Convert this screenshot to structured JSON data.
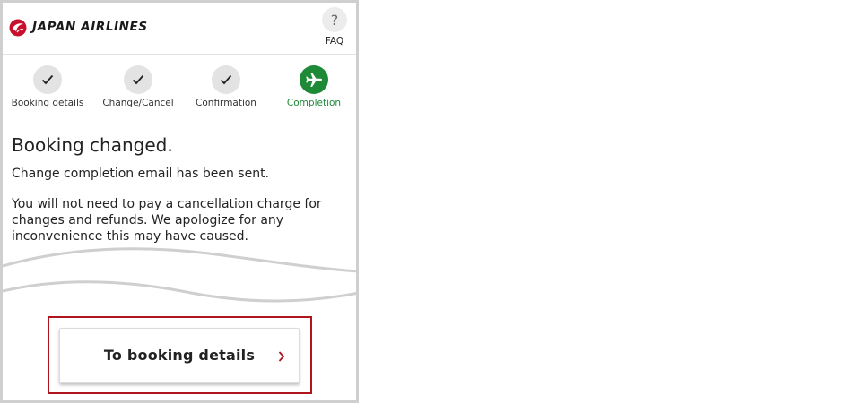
{
  "header": {
    "brand": "JAPAN AIRLINES",
    "faq_icon_glyph": "?",
    "faq_label": "FAQ"
  },
  "stepper": {
    "steps": [
      {
        "label": "Booking details",
        "state": "done"
      },
      {
        "label": "Change/Cancel",
        "state": "done"
      },
      {
        "label": "Confirmation",
        "state": "done"
      },
      {
        "label": "Completion",
        "state": "active"
      }
    ]
  },
  "main": {
    "title": "Booking changed.",
    "email_notice": "Change completion email has been sent.",
    "charge_notice": "You will not need to pay a cancellation charge for changes and refunds. We apologize for any inconvenience this may have caused."
  },
  "actions": {
    "to_booking_details_label": "To booking details"
  },
  "colors": {
    "brand_red": "#c8102e",
    "completion_green": "#1e8a38",
    "highlight_red": "#b0141c"
  }
}
